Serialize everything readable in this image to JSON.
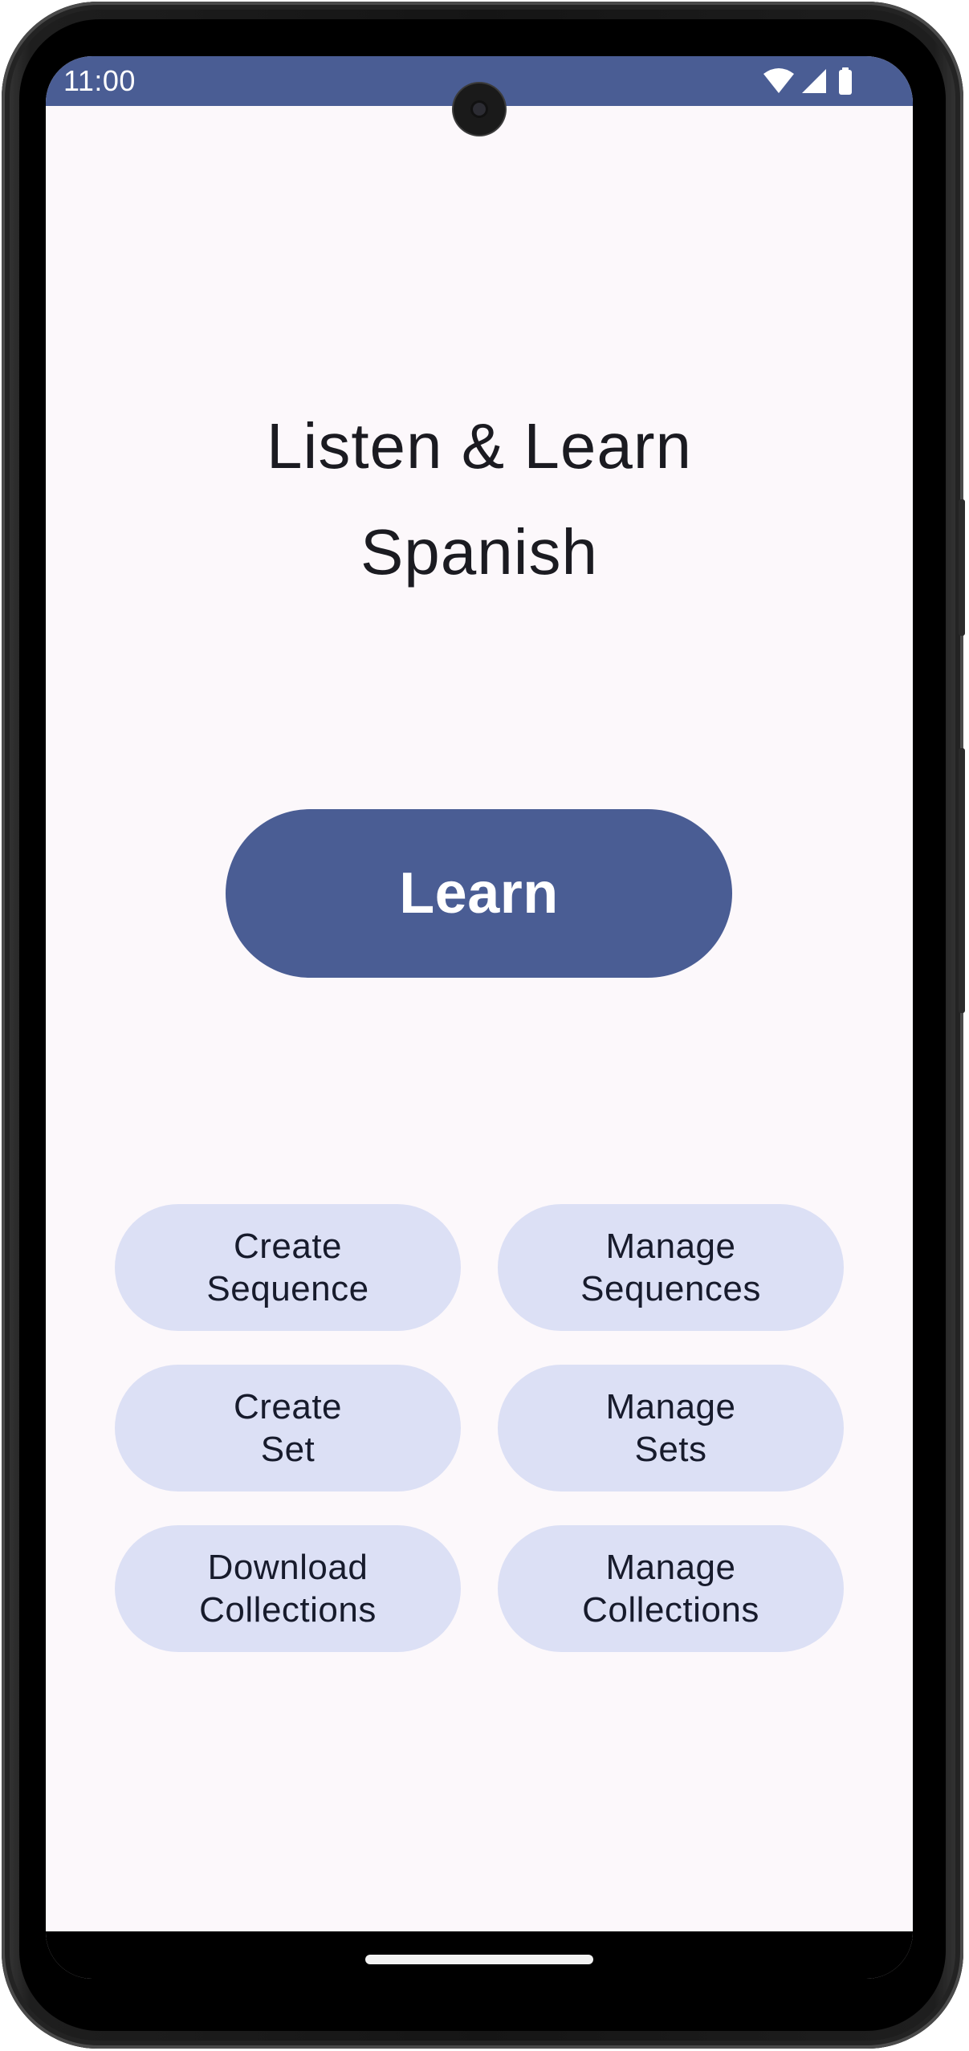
{
  "status_bar": {
    "time": "11:00",
    "icons": [
      "wifi-icon",
      "cell-signal-icon",
      "battery-icon"
    ],
    "background": "#4a5d94"
  },
  "app": {
    "title_line1": "Listen & Learn",
    "title_line2": "Spanish"
  },
  "primary_action": {
    "label": "Learn",
    "color": "#4a5d94"
  },
  "actions": [
    {
      "line1": "Create",
      "line2": "Sequence"
    },
    {
      "line1": "Manage",
      "line2": "Sequences"
    },
    {
      "line1": "Create",
      "line2": "Set"
    },
    {
      "line1": "Manage",
      "line2": "Sets"
    },
    {
      "line1": "Download",
      "line2": "Collections"
    },
    {
      "line1": "Manage",
      "line2": "Collections"
    }
  ],
  "colors": {
    "background": "#fcf8fb",
    "secondary_button": "#dce0f5",
    "text": "#1b1b21"
  }
}
